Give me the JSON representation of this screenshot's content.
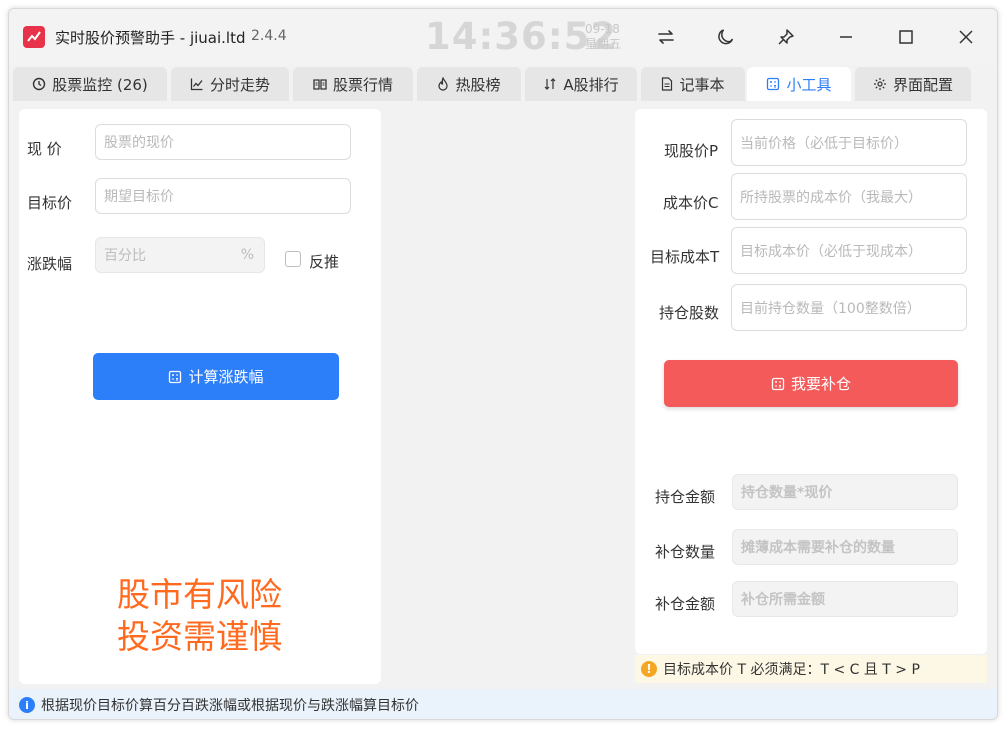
{
  "app": {
    "title": "实时股价预警助手 - jiuai.ltd",
    "version": "2.4.4",
    "clock": "14:36:52",
    "date": "09-18",
    "weekday": "星期五"
  },
  "titlebar_icons": [
    "swap-arrows-icon",
    "moon-icon",
    "pin-icon",
    "minimize-icon",
    "maximize-icon",
    "close-icon"
  ],
  "tabs": [
    {
      "label": "股票监控 (26)",
      "icon": "clock-icon"
    },
    {
      "label": "分时走势",
      "icon": "line-chart-icon"
    },
    {
      "label": "股票行情",
      "icon": "book-icon"
    },
    {
      "label": "热股榜",
      "icon": "flame-icon"
    },
    {
      "label": "A股排行",
      "icon": "sort-icon"
    },
    {
      "label": "记事本",
      "icon": "note-icon"
    },
    {
      "label": "小工具",
      "icon": "calculator-icon",
      "active": true
    },
    {
      "label": "界面配置",
      "icon": "gear-icon"
    }
  ],
  "calc": {
    "price_label": "现  价",
    "price_placeholder": "股票的现价",
    "target_label": "目标价",
    "target_placeholder": "期望目标价",
    "change_label": "涨跌幅",
    "change_placeholder": "百分比",
    "change_suffix": "%",
    "reverse_label": "反推",
    "button": "计算涨跌幅",
    "warning_line1": "股市有风险",
    "warning_line2": "投资需谨慎"
  },
  "cover": {
    "price_label": "现股价P",
    "price_placeholder": "当前价格（必低于目标价）",
    "cost_label": "成本价C",
    "cost_placeholder": "所持股票的成本价（我最大）",
    "target_label": "目标成本T",
    "target_placeholder": "目标成本价（必低于现成本）",
    "shares_label": "持仓股数",
    "shares_placeholder": "目前持仓数量（100整数倍）",
    "button": "我要补仓",
    "holding_amount_label": "持仓金额",
    "holding_amount_placeholder": "持仓数量*现价",
    "add_qty_label": "补仓数量",
    "add_qty_placeholder": "摊薄成本需要补仓的数量",
    "add_amount_label": "补仓金额",
    "add_amount_placeholder": "补仓所需金额",
    "hint": "目标成本价 T 必须满足：T < C 且 T > P"
  },
  "status": {
    "text": "根据现价目标价算百分百跌涨幅或根据现价与跌涨幅算目标价"
  },
  "colors": {
    "accent": "#2d7ff9",
    "danger": "#f55a5a",
    "warning": "#ff6a1f",
    "app_icon": "#e8324a"
  }
}
